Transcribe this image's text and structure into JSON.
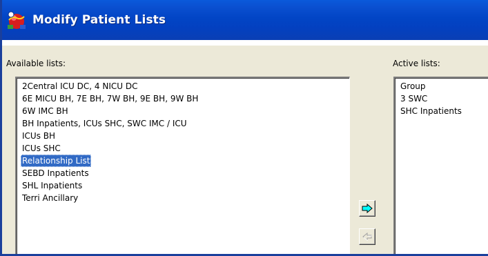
{
  "window": {
    "title": "Modify Patient Lists",
    "icon": "doctor-globe-icon"
  },
  "available": {
    "label": "Available lists:",
    "items": [
      "2Central ICU DC, 4 NICU DC",
      "6E MICU BH, 7E BH, 7W BH, 9E BH, 9W BH",
      "6W IMC BH",
      "BH Inpatients, ICUs SHC, SWC IMC / ICU",
      "ICUs BH",
      "ICUs SHC",
      "Relationship List",
      "SEBD Inpatients",
      "SHL Inpatients",
      "Terri Ancillary"
    ],
    "selected_index": 6
  },
  "active": {
    "label": "Active lists:",
    "items": [
      "Group",
      "3 SWC",
      "SHC Inpatients"
    ]
  },
  "buttons": {
    "add_icon": "arrow-right-icon",
    "remove_icon": "arrow-left-icon",
    "add_enabled": true,
    "remove_enabled": false
  },
  "colors": {
    "titlebar": "#0a4fd0",
    "selection": "#316ac5",
    "add_arrow_fill": "#00ffff"
  }
}
